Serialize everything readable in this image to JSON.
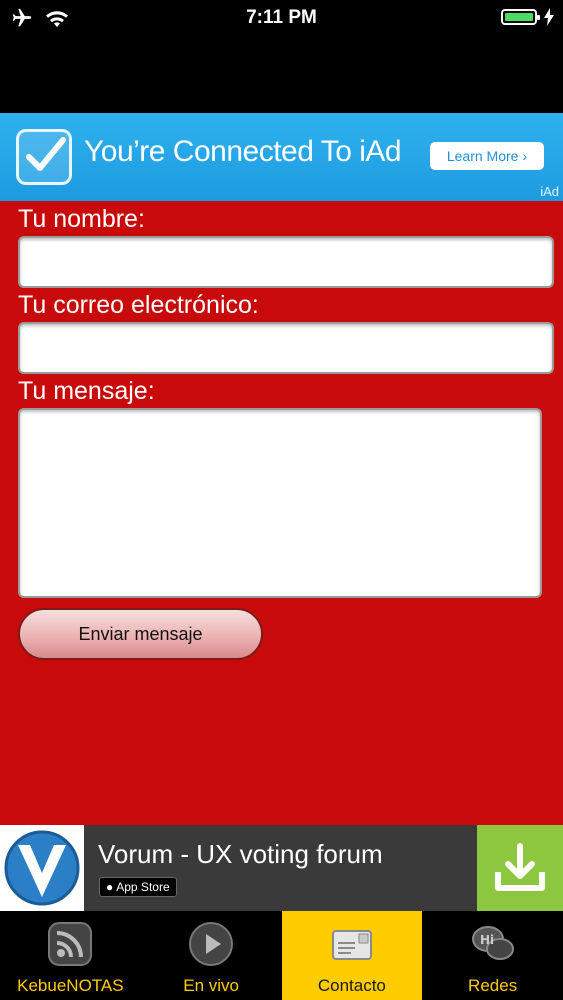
{
  "status_bar": {
    "time": "7:11 PM"
  },
  "iad_banner": {
    "title": "You’re Connected To iAd",
    "learn_more": "Learn More",
    "brand": "iAd"
  },
  "form": {
    "name_label": "Tu nombre:",
    "email_label": "Tu correo electrónico:",
    "message_label": "Tu mensaje:",
    "name_value": "",
    "email_value": "",
    "message_value": "",
    "send_label": "Enviar mensaje"
  },
  "ad_banner": {
    "title": "Vorum - UX voting forum",
    "store_label": "App Store"
  },
  "tabs": [
    {
      "label": "KebueNOTAS",
      "icon": "rss-icon",
      "active": false
    },
    {
      "label": "En vivo",
      "icon": "play-icon",
      "active": false
    },
    {
      "label": "Contacto",
      "icon": "mail-icon",
      "active": true
    },
    {
      "label": "Redes",
      "icon": "chat-bubbles-icon",
      "active": false
    }
  ],
  "colors": {
    "form_background": "#c90a0a",
    "tab_active": "#ffcc00",
    "iad_blue": "#1d9be0",
    "download_green": "#8dc63f"
  }
}
